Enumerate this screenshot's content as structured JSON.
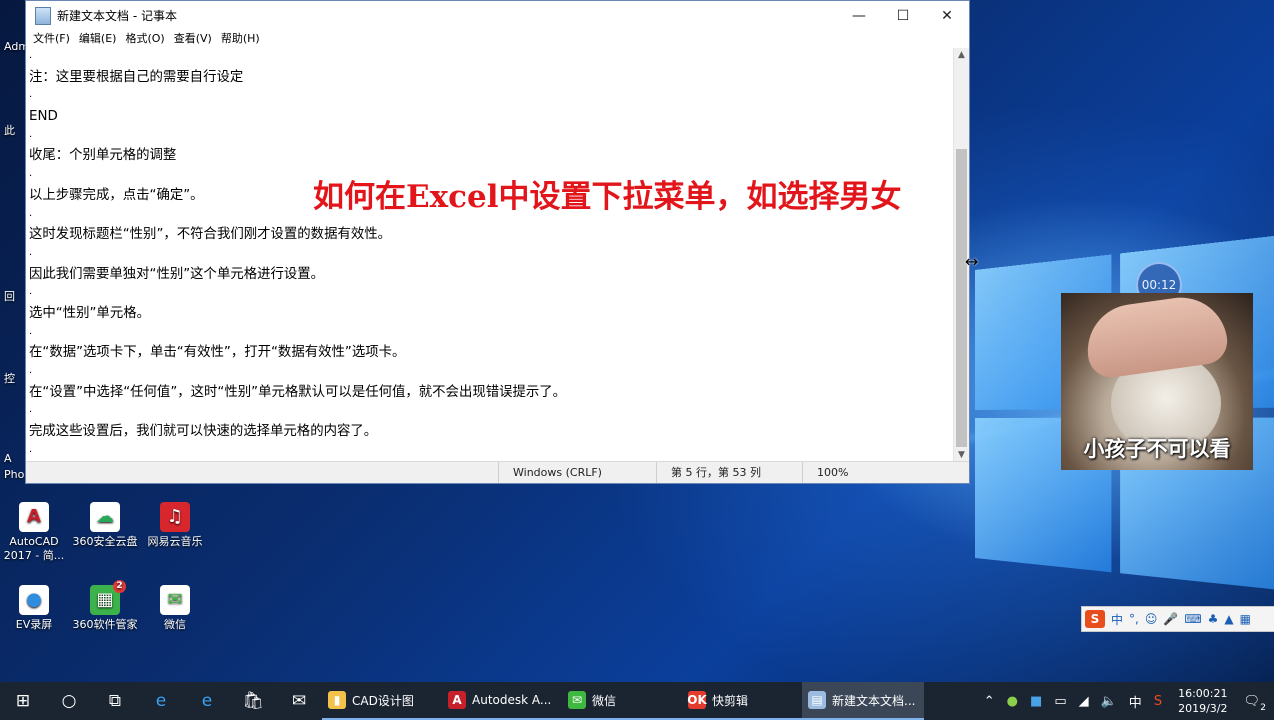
{
  "notepad": {
    "title": "新建文本文档 - 记事本",
    "menu": [
      "文件(F)",
      "编辑(E)",
      "格式(O)",
      "查看(V)",
      "帮助(H)"
    ],
    "lines": [
      ".",
      "注：这里要根据自己的需要自行设定",
      ".",
      "END",
      ".",
      "收尾：个别单元格的调整",
      ".",
      "以上步骤完成，点击“确定”。",
      ".",
      "这时发现标题栏“性别”，不符合我们刚才设置的数据有效性。",
      ".",
      "因此我们需要单独对“性别”这个单元格进行设置。",
      ".",
      "选中“性别”单元格。",
      ".",
      "在“数据”选项卡下，单击“有效性”，打开“数据有效性”选项卡。",
      ".",
      "在“设置”中选择“任何值”，这时“性别”单元格默认可以是任何值，就不会出现错误提示了。",
      ".",
      "完成这些设置后，我们就可以快速的选择单元格的内容了。",
      "."
    ],
    "overlay_title": "如何在Excel中设置下拉菜单，如选择男女",
    "status": {
      "encoding": "Windows (CRLF)",
      "position": "第 5 行，第 53 列",
      "zoom": "100%"
    }
  },
  "desktop_icons": [
    {
      "label": "AutoCAD 2017 - 简...",
      "glyph": "A",
      "color": "#c8202a"
    },
    {
      "label": "360安全云盘",
      "glyph": "☁",
      "color": "#2aa85a"
    },
    {
      "label": "网易云音乐",
      "glyph": "♫",
      "color": "#d8262d"
    },
    {
      "label": "EV录屏",
      "glyph": "●",
      "color": "#2f8de0"
    },
    {
      "label": "360软件管家",
      "glyph": "▦",
      "color": "#3cb34a",
      "badge": "2"
    },
    {
      "label": "微信",
      "glyph": "✉",
      "color": "#3fb83f"
    }
  ],
  "edge_labels": [
    "Adm",
    "此",
    "回",
    "控",
    "A",
    "Pho"
  ],
  "webcam": {
    "caption": "小孩子不可以看",
    "timer": "00:12"
  },
  "ime": {
    "lang": "中"
  },
  "taskbar": {
    "apps": [
      {
        "label": "CAD设计图",
        "glyph": "▮",
        "color": "#f2c24b",
        "active": false
      },
      {
        "label": "Autodesk A...",
        "glyph": "A",
        "color": "#c8202a",
        "active": false
      },
      {
        "label": "微信",
        "glyph": "✉",
        "color": "#3fb83f",
        "active": false
      },
      {
        "label": "快剪辑",
        "glyph": "OK",
        "color": "#e33c2f",
        "active": false
      },
      {
        "label": "新建文本文档...",
        "glyph": "▤",
        "color": "#9bbbe0",
        "active": true
      }
    ],
    "tray_lang": "中",
    "time": "16:00:21",
    "date": "2019/3/2",
    "notification_count": "2"
  }
}
